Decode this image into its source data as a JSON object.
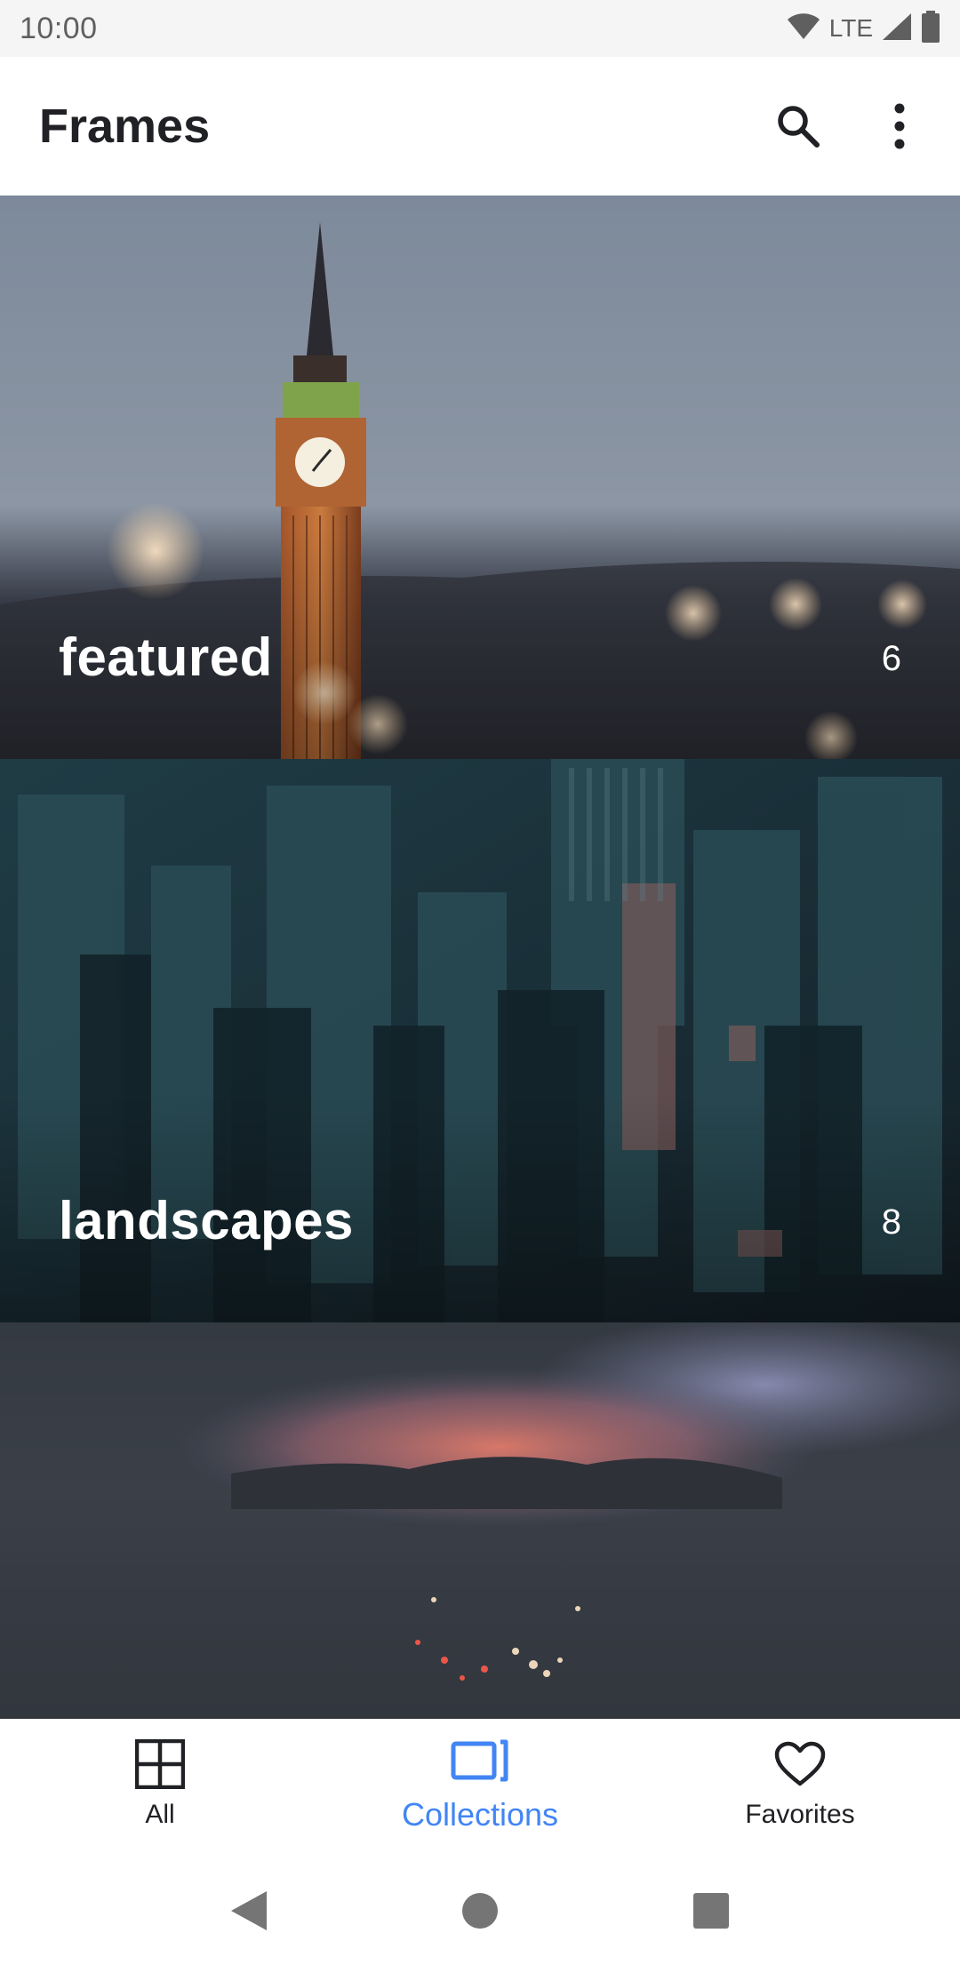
{
  "status_bar": {
    "time": "10:00",
    "network": "LTE",
    "icons": [
      "wifi-icon",
      "signal-icon",
      "battery-icon"
    ]
  },
  "app_bar": {
    "title": "Frames",
    "actions": [
      "search-icon",
      "more-vert-icon"
    ]
  },
  "collections": [
    {
      "title": "featured",
      "count": "6"
    },
    {
      "title": "landscapes",
      "count": "8"
    },
    {
      "title": "",
      "count": ""
    }
  ],
  "bottom_nav": {
    "items": [
      {
        "label": "All",
        "icon": "grid-icon",
        "active": false
      },
      {
        "label": "Collections",
        "icon": "collections-icon",
        "active": true
      },
      {
        "label": "Favorites",
        "icon": "heart-icon",
        "active": false
      }
    ]
  },
  "colors": {
    "accent": "#4285f4",
    "text_primary": "#202124",
    "status_bar_bg": "#f5f5f5"
  },
  "system_nav": [
    "back-icon",
    "home-icon",
    "recents-icon"
  ]
}
